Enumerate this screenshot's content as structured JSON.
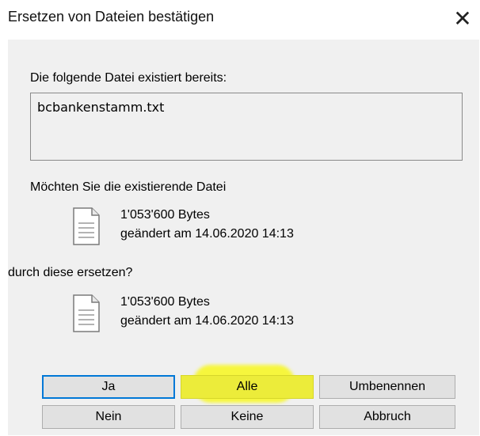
{
  "dialog": {
    "title": "Ersetzen von Dateien bestätigen",
    "close_symbol": "✕"
  },
  "message": {
    "exists_label": "Die folgende Datei existiert bereits:",
    "filename": "bcbankenstamm.txt",
    "question_existing": "Möchten Sie die existierende Datei",
    "question_replace": "durch diese ersetzen?"
  },
  "existing_file": {
    "size": "1'053'600 Bytes",
    "modified": "geändert am 14.06.2020 14:13",
    "icon": "document-icon"
  },
  "new_file": {
    "size": "1'053'600 Bytes",
    "modified": "geändert am 14.06.2020 14:13",
    "icon": "document-icon"
  },
  "buttons": {
    "ja": "Ja",
    "alle": "Alle",
    "umbenennen": "Umbenennen",
    "nein": "Nein",
    "keine": "Keine",
    "abbruch": "Abbruch"
  },
  "colors": {
    "default_button_border": "#0078d7",
    "highlight": "#f7f72a"
  }
}
